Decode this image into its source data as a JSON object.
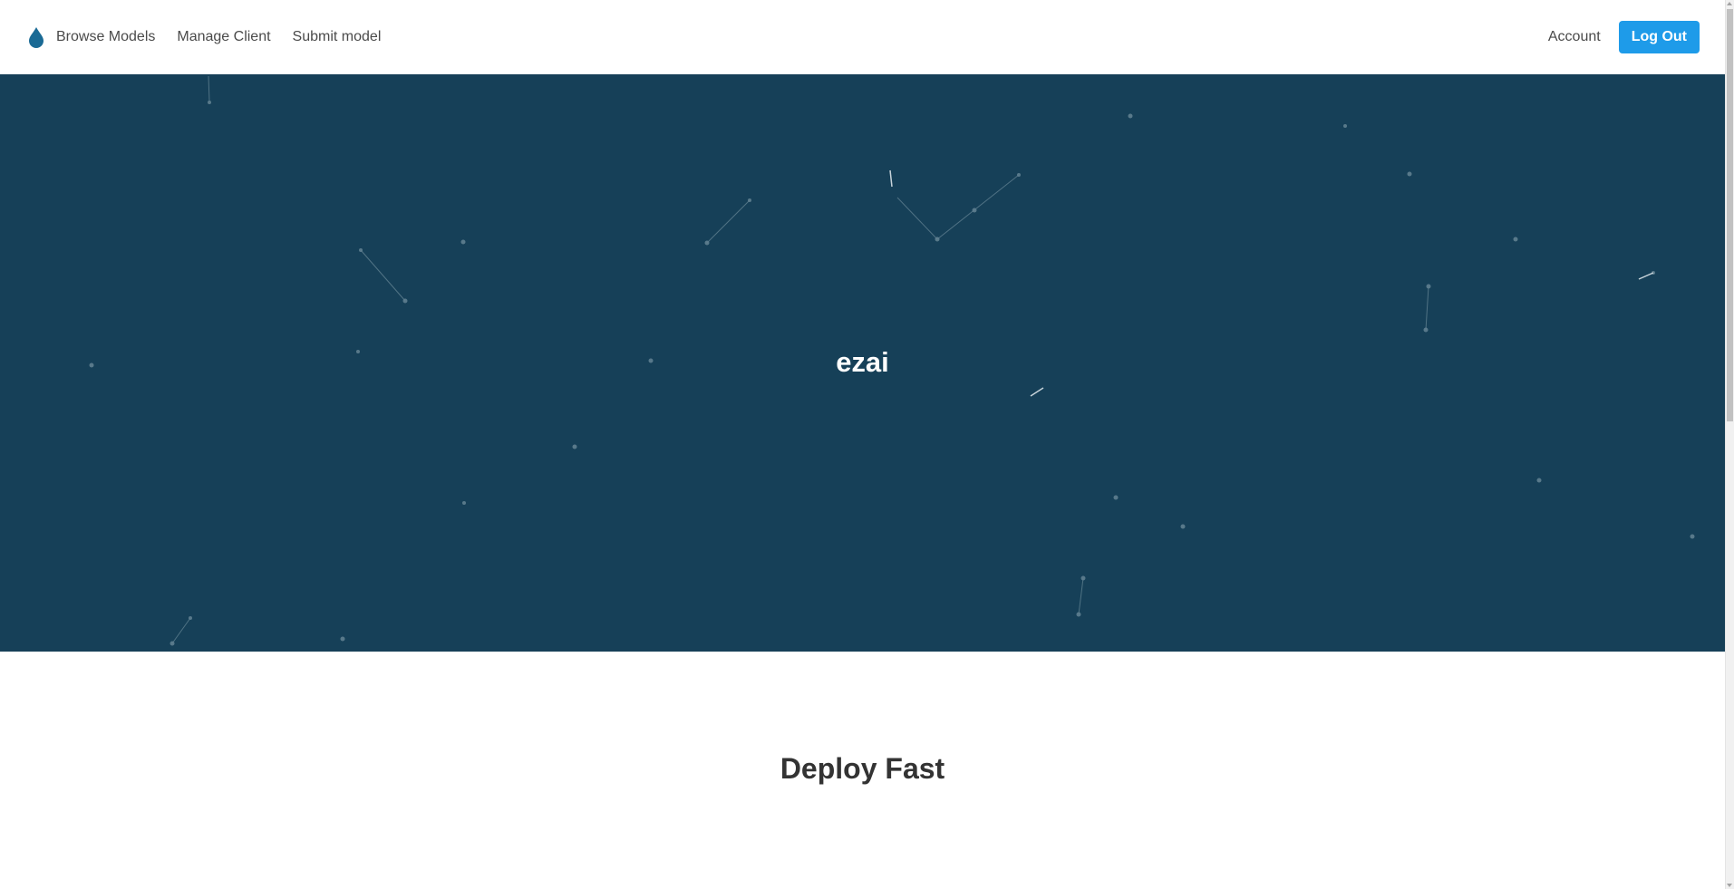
{
  "navbar": {
    "brand_icon": "droplet-icon",
    "links": [
      {
        "label": "Browse Models"
      },
      {
        "label": "Manage Client"
      },
      {
        "label": "Submit model"
      }
    ],
    "account_label": "Account",
    "logout_label": "Log Out"
  },
  "hero": {
    "title": "ezai"
  },
  "section": {
    "title": "Deploy Fast"
  },
  "colors": {
    "hero_background": "#164058",
    "accent_button": "#1e9be9",
    "brand_icon": "#1a6a95",
    "particle": "#5a7a8c"
  }
}
